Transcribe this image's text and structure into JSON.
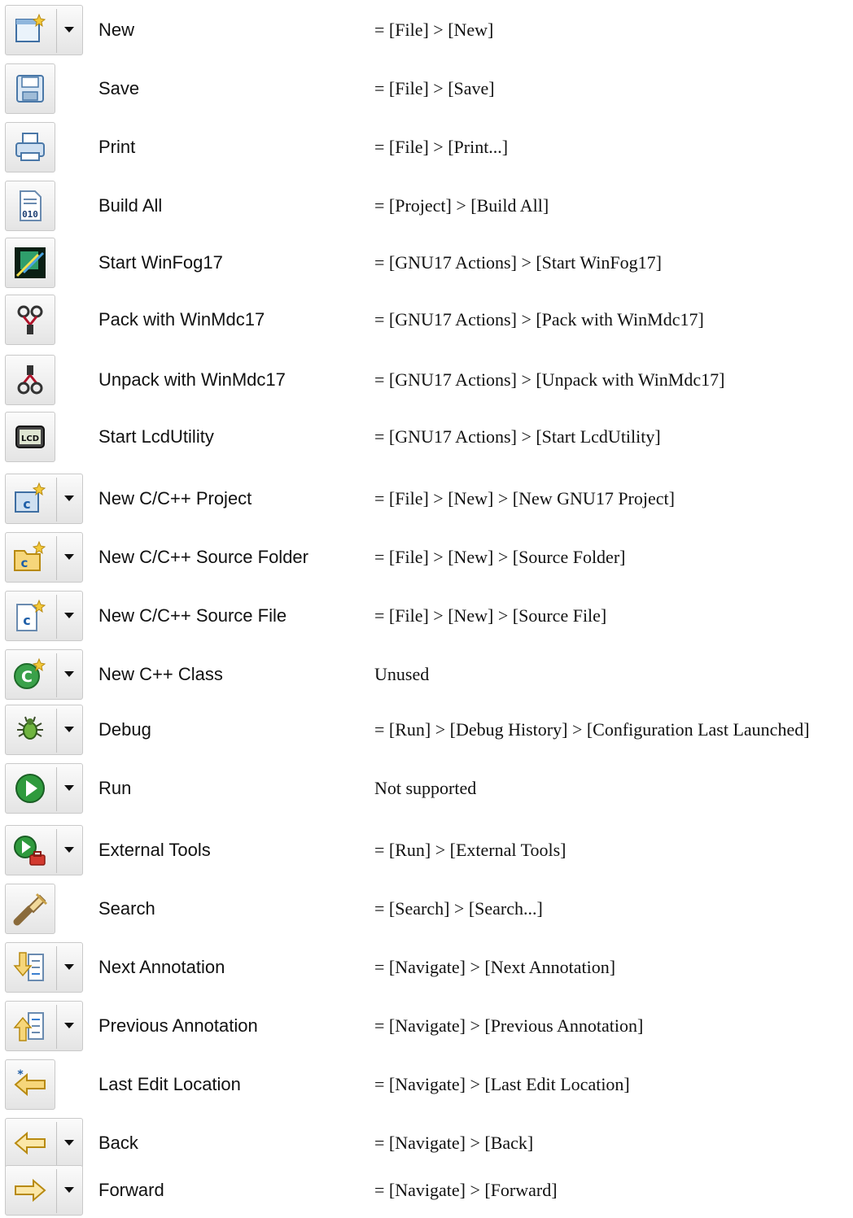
{
  "rows": [
    {
      "label": "New",
      "menu": "= [File] > [New]",
      "icon": "new-wizard-icon",
      "dropdown": true
    },
    {
      "label": "Save",
      "menu": "= [File] > [Save]",
      "icon": "save-icon",
      "dropdown": false
    },
    {
      "label": "Print",
      "menu": "= [File] > [Print...]",
      "icon": "print-icon",
      "dropdown": false
    },
    {
      "label": "Build All",
      "menu": "= [Project] > [Build All]",
      "icon": "build-all-icon",
      "dropdown": false
    },
    {
      "label": "Start WinFog17",
      "menu": "= [GNU17 Actions] > [Start WinFog17]",
      "icon": "winfog-icon",
      "dropdown": false
    },
    {
      "label": "Pack with WinMdc17",
      "menu": "= [GNU17 Actions] > [Pack with WinMdc17]",
      "icon": "pack-icon",
      "dropdown": false
    },
    {
      "label": "Unpack with WinMdc17",
      "menu": "= [GNU17 Actions] > [Unpack with WinMdc17]",
      "icon": "unpack-icon",
      "dropdown": false
    },
    {
      "label": "Start LcdUtility",
      "menu": "= [GNU17 Actions] > [Start LcdUtility]",
      "icon": "lcd-icon",
      "dropdown": false
    },
    {
      "label": "New C/C++ Project",
      "menu": "= [File] > [New] > [New GNU17 Project]",
      "icon": "new-c-project-icon",
      "dropdown": true
    },
    {
      "label": "New C/C++ Source Folder",
      "menu": "= [File] > [New] > [Source Folder]",
      "icon": "new-source-folder-icon",
      "dropdown": true
    },
    {
      "label": "New C/C++ Source File",
      "menu": "= [File] > [New] > [Source File]",
      "icon": "new-source-file-icon",
      "dropdown": true
    },
    {
      "label": "New C++ Class",
      "menu": "Unused",
      "icon": "new-class-icon",
      "dropdown": true
    },
    {
      "label": "Debug",
      "menu": "= [Run] > [Debug History] > [Configuration Last Launched]",
      "icon": "debug-bug-icon",
      "dropdown": true
    },
    {
      "label": "Run",
      "menu": "Not supported",
      "icon": "run-icon",
      "dropdown": true
    },
    {
      "label": "External Tools",
      "menu": "= [Run] > [External Tools]",
      "icon": "external-tools-icon",
      "dropdown": true
    },
    {
      "label": "Search",
      "menu": "= [Search] > [Search...]",
      "icon": "search-flashlight-icon",
      "dropdown": false
    },
    {
      "label": "Next Annotation",
      "menu": "= [Navigate] > [Next Annotation]",
      "icon": "next-annotation-icon",
      "dropdown": true
    },
    {
      "label": "Previous Annotation",
      "menu": "= [Navigate] > [Previous Annotation]",
      "icon": "previous-annotation-icon",
      "dropdown": true
    },
    {
      "label": "Last Edit Location",
      "menu": "= [Navigate] > [Last Edit Location]",
      "icon": "last-edit-location-icon",
      "dropdown": false
    },
    {
      "label": "Back",
      "menu": "= [Navigate] > [Back]",
      "icon": "back-arrow-icon",
      "dropdown": true
    },
    {
      "label": "Forward",
      "menu": "= [Navigate] > [Forward]",
      "icon": "forward-arrow-icon",
      "dropdown": true
    }
  ]
}
